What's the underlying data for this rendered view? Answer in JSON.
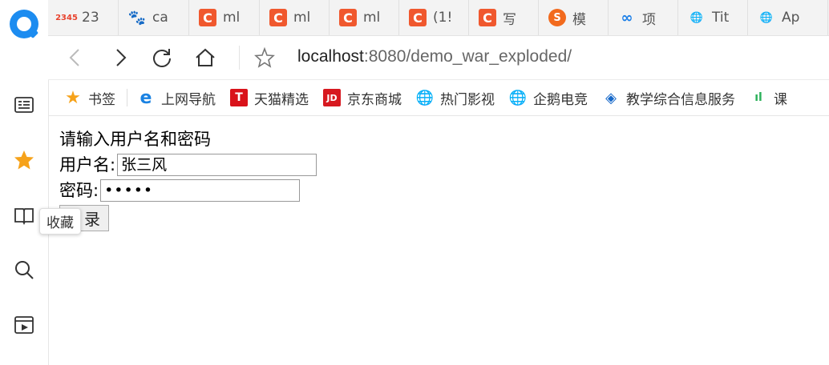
{
  "tabs": [
    {
      "icon": "2345-icon",
      "text": "23"
    },
    {
      "icon": "baidu-icon",
      "text": "ca"
    },
    {
      "icon": "csdn-icon",
      "text": "ml"
    },
    {
      "icon": "csdn-icon",
      "text": "ml"
    },
    {
      "icon": "csdn-icon",
      "text": "ml"
    },
    {
      "icon": "csdn-icon",
      "text": "(1!"
    },
    {
      "icon": "csdn-icon",
      "text": "写"
    },
    {
      "icon": "sogou-icon",
      "text": "模"
    },
    {
      "icon": "xiangmu-icon",
      "text": "项"
    },
    {
      "icon": "globe-icon",
      "text": "Tit"
    },
    {
      "icon": "globe-icon",
      "text": "Ap"
    }
  ],
  "address": {
    "host": "localhost",
    "rest": ":8080/demo_war_exploded/"
  },
  "bookmarks": [
    {
      "icon": "star-icon",
      "label": "书签"
    },
    {
      "icon": "ie-icon",
      "label": "上网导航"
    },
    {
      "icon": "tmall-icon",
      "label": "天猫精选"
    },
    {
      "icon": "jd-icon",
      "label": "京东商城"
    },
    {
      "icon": "globe-icon",
      "label": "热门影视"
    },
    {
      "icon": "globe-icon",
      "label": "企鹅电竞"
    },
    {
      "icon": "cube-icon",
      "label": "教学综合信息服务"
    },
    {
      "icon": "wave-icon",
      "label": "课"
    }
  ],
  "page": {
    "heading": "请输入用户名和密码",
    "username_label": "用户名:",
    "username_value": "张三风",
    "password_label": "密码:",
    "password_value": "•••••",
    "login_label": "录"
  },
  "tooltip": "收藏",
  "colors": {
    "accent": "#1c8cf0",
    "csdn": "#f0582e",
    "star": "#f6a21a"
  }
}
